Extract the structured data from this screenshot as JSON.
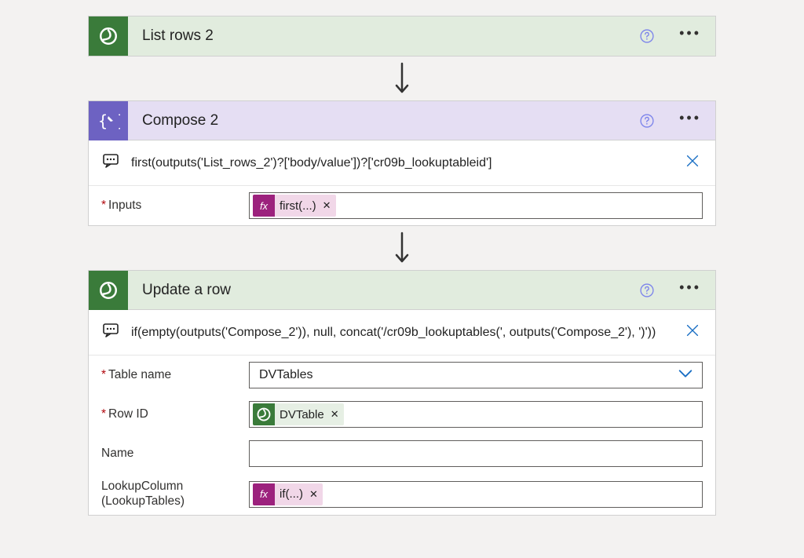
{
  "cards": {
    "listRows": {
      "title": "List rows 2"
    },
    "compose": {
      "title": "Compose 2",
      "peek": "first(outputs('List_rows_2')?['body/value'])?['cr09b_lookuptableid']",
      "inputsLabel": "Inputs",
      "pill": "first(...)"
    },
    "updateRow": {
      "title": "Update a row",
      "peek": "if(empty(outputs('Compose_2')), null, concat('/cr09b_lookuptables(', outputs('Compose_2'), ')'))",
      "tableNameLabel": "Table name",
      "tableNameValue": "DVTables",
      "rowIdLabel": "Row ID",
      "rowIdPill": "DVTable",
      "nameLabel": "Name",
      "lookupLabel": "LookupColumn (LookupTables)",
      "lookupPill": "if(...)"
    }
  },
  "glyphs": {
    "close_x": "✕"
  }
}
